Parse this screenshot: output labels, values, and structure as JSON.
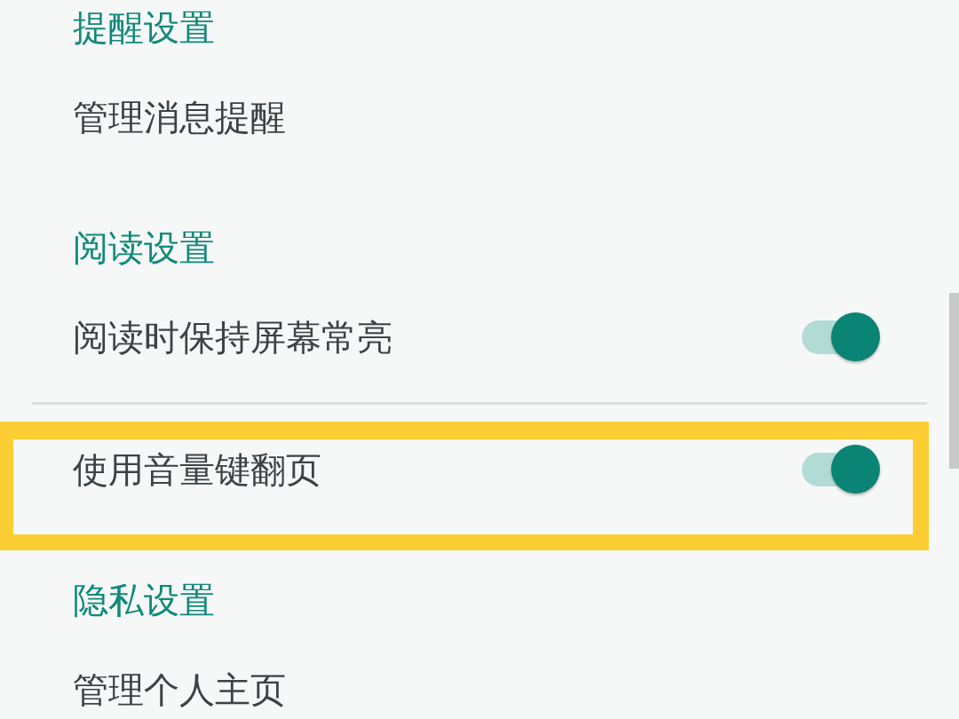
{
  "sections": [
    {
      "title": "提醒设置",
      "items": [
        {
          "label": "管理消息提醒",
          "kind": "link",
          "highlighted": false
        }
      ]
    },
    {
      "title": "阅读设置",
      "items": [
        {
          "label": "阅读时保持屏幕常亮",
          "kind": "switch",
          "on": true,
          "highlighted": false
        },
        {
          "label": "使用音量键翻页",
          "kind": "switch",
          "on": true,
          "highlighted": true
        }
      ]
    },
    {
      "title": "隐私设置",
      "items": [
        {
          "label": "管理个人主页",
          "kind": "link",
          "highlighted": false
        }
      ]
    }
  ]
}
